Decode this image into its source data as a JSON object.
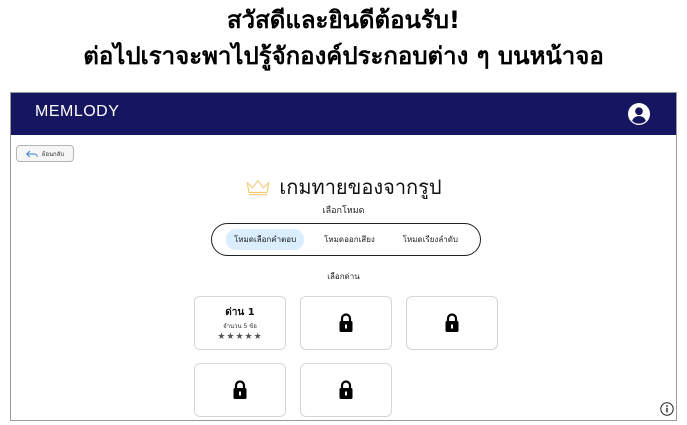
{
  "caption": {
    "line1": "สวัสดีและยินดีต้อนรับ!",
    "line2": "ต่อไปเราจะพาไปรู้จักองค์ประกอบต่าง ๆ บนหน้าจอ"
  },
  "navbar": {
    "brand": "MEMLODY",
    "user_icon": "user-circle-icon",
    "bg_color": "#16155f"
  },
  "back_button": {
    "label": "ย้อนกลับ",
    "icon": "back-arrow-icon"
  },
  "page": {
    "title": "เกมทายของจากรูป",
    "title_icon": "crown-icon",
    "mode_label": "เลือกโหมด",
    "level_label": "เลือกด่าน"
  },
  "modes": [
    {
      "label": "โหมดเลือกคำตอบ",
      "active": true
    },
    {
      "label": "โหมดออกเสียง",
      "active": false
    },
    {
      "label": "โหมดเรียงลำดับ",
      "active": false
    }
  ],
  "levels": [
    {
      "name": "ด่าน 1",
      "subtitle": "จำนวน 5 ข้อ",
      "stars": "★★★★★",
      "locked": false
    },
    {
      "locked": true,
      "icon": "lock-icon"
    },
    {
      "locked": true,
      "icon": "lock-icon"
    },
    {
      "locked": true,
      "icon": "lock-icon"
    },
    {
      "locked": true,
      "icon": "lock-icon"
    }
  ],
  "info_icon": "info-icon",
  "active_mode_color": "#dbeeff"
}
